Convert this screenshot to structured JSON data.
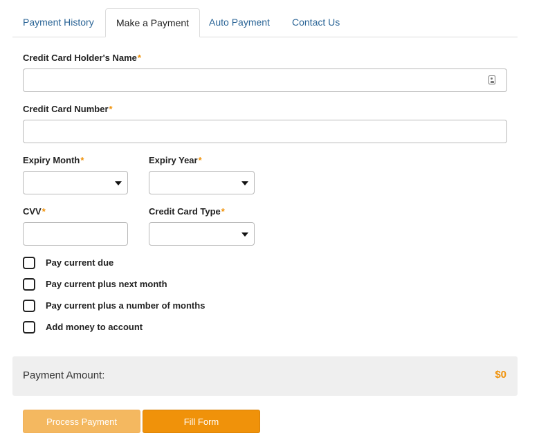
{
  "tabs": [
    {
      "label": "Payment History",
      "active": false
    },
    {
      "label": "Make a Payment",
      "active": true
    },
    {
      "label": "Auto Payment",
      "active": false
    },
    {
      "label": "Contact Us",
      "active": false
    }
  ],
  "form": {
    "required_marker": "*",
    "holder_name": {
      "label": "Credit Card Holder's Name",
      "value": ""
    },
    "card_number": {
      "label": "Credit Card Number",
      "value": ""
    },
    "expiry_month": {
      "label": "Expiry Month",
      "value": ""
    },
    "expiry_year": {
      "label": "Expiry Year",
      "value": ""
    },
    "cvv": {
      "label": "CVV",
      "value": ""
    },
    "card_type": {
      "label": "Credit Card Type",
      "value": ""
    }
  },
  "options": [
    {
      "label": "Pay current due",
      "checked": false
    },
    {
      "label": "Pay current plus next month",
      "checked": false
    },
    {
      "label": "Pay current plus a number of months",
      "checked": false
    },
    {
      "label": "Add money to account",
      "checked": false
    }
  ],
  "summary": {
    "label": "Payment Amount:",
    "value": "$0"
  },
  "buttons": {
    "process": "Process Payment",
    "fill": "Fill Form"
  },
  "colors": {
    "accent": "#f0920a",
    "accent_light": "#f4b860",
    "link": "#2a6496"
  }
}
